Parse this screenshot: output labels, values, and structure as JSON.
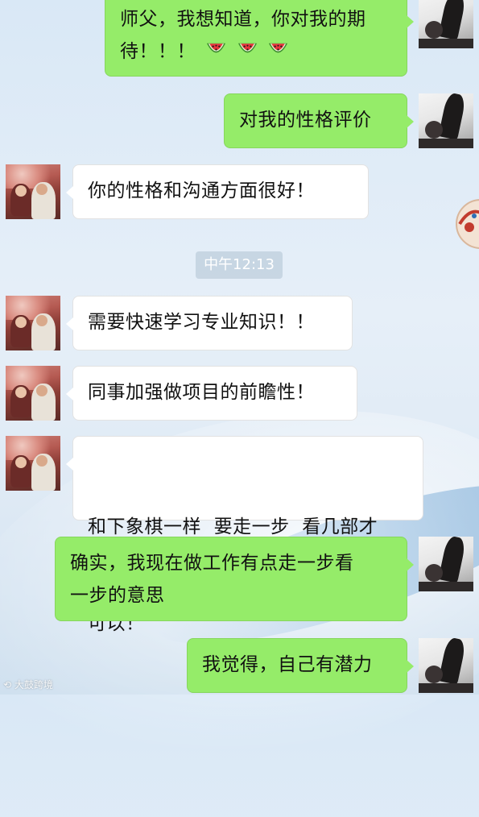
{
  "chat": {
    "messages": [
      {
        "sender": "self",
        "lines": [
          "师父，我想知道，你对我的期",
          "待！！！"
        ],
        "emoji": [
          "watermelon",
          "watermelon",
          "watermelon"
        ]
      },
      {
        "sender": "self",
        "text": "对我的性格评价"
      },
      {
        "sender": "other",
        "text": "你的性格和沟通方面很好！"
      },
      {
        "sender": "other",
        "text": "需要快速学习专业知识！！"
      },
      {
        "sender": "other",
        "text": "同事加强做项目的前瞻性！"
      },
      {
        "sender": "other",
        "lines": [
          "和下象棋一样  要走一步  看几部才",
          "可以！"
        ]
      },
      {
        "sender": "self",
        "lines": [
          "确实，我现在做工作有点走一步看",
          "一步的意思"
        ]
      },
      {
        "sender": "self",
        "text": "我觉得，自己有潜力"
      }
    ],
    "timestamp": "中午12:13"
  },
  "watermark": {
    "text": "大鼓跨境"
  },
  "colors": {
    "self_bubble": "#95ec69",
    "other_bubble": "#ffffff",
    "background": "#e2edf7"
  }
}
